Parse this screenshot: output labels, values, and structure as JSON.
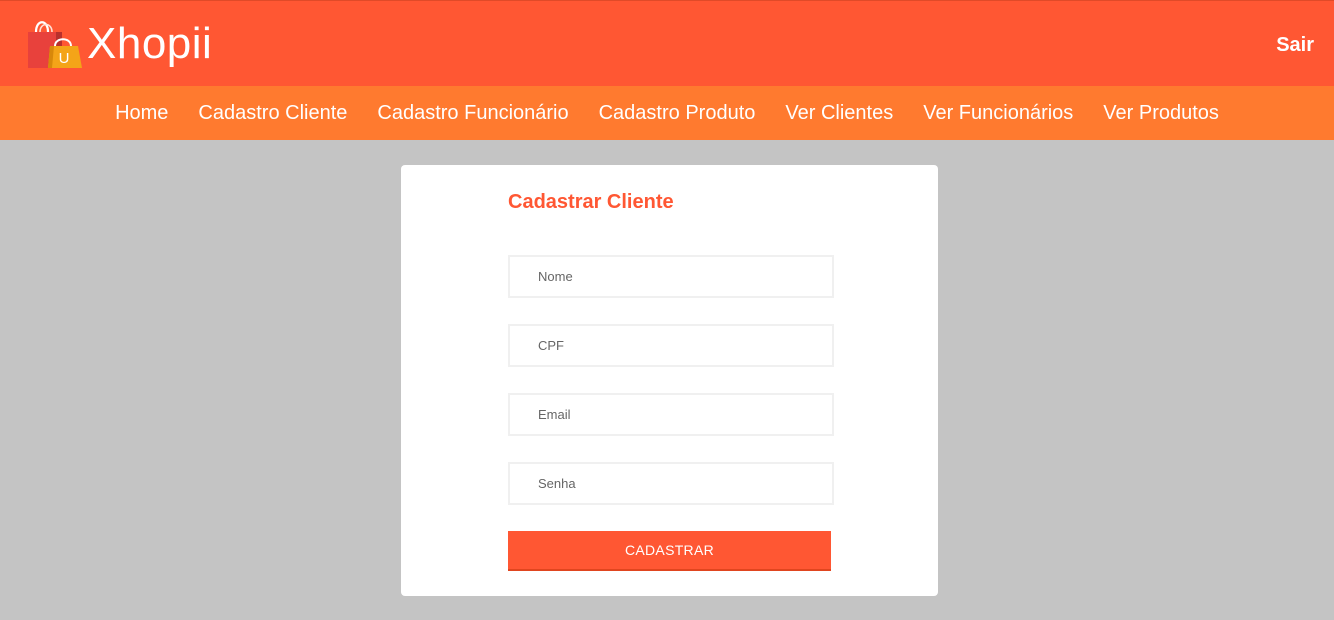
{
  "header": {
    "brand": "Xhopii",
    "logout_label": "Sair",
    "colors": {
      "primary": "#ff5733",
      "nav": "#ff7a2f",
      "background": "#c4c4c4"
    }
  },
  "nav": {
    "items": [
      {
        "label": "Home"
      },
      {
        "label": "Cadastro Cliente"
      },
      {
        "label": "Cadastro Funcionário"
      },
      {
        "label": "Cadastro Produto"
      },
      {
        "label": "Ver Clientes"
      },
      {
        "label": "Ver Funcionários"
      },
      {
        "label": "Ver Produtos"
      }
    ]
  },
  "form": {
    "title": "Cadastrar Cliente",
    "fields": {
      "nome": {
        "placeholder": "Nome",
        "value": ""
      },
      "cpf": {
        "placeholder": "CPF",
        "value": ""
      },
      "email": {
        "placeholder": "Email",
        "value": ""
      },
      "senha": {
        "placeholder": "Senha",
        "value": ""
      }
    },
    "submit_label": "CADASTRAR"
  },
  "icons": {
    "logo": "shopping-bags-icon"
  }
}
